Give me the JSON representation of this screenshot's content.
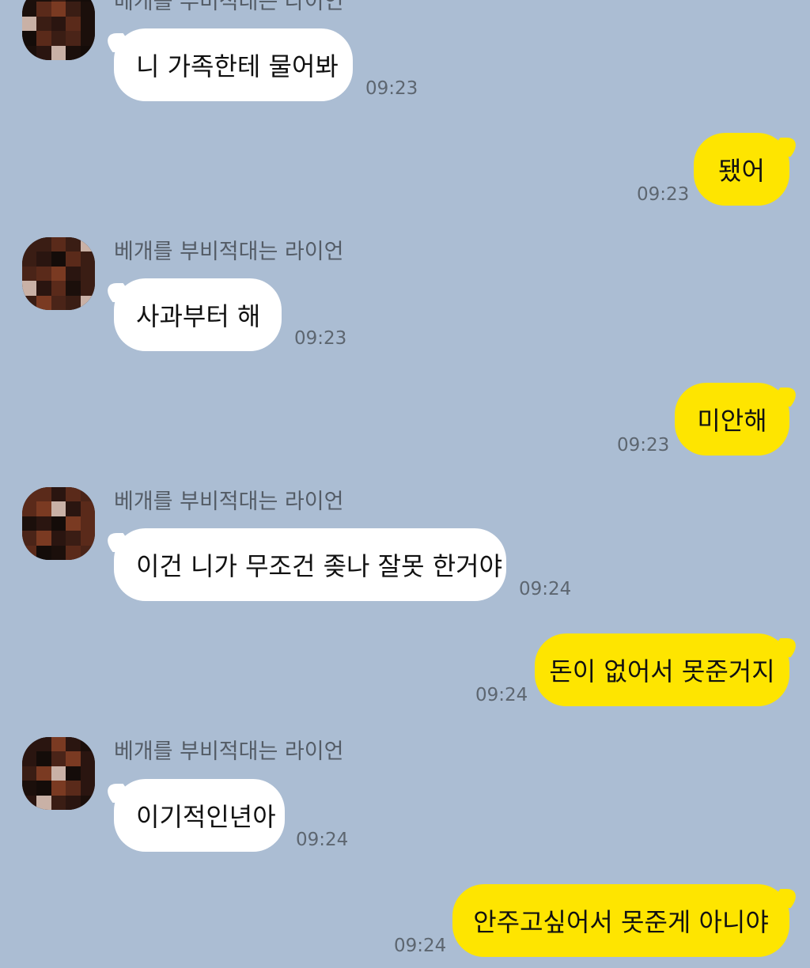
{
  "messages": [
    {
      "side": "in",
      "sender": "베개를 부비적대는 라이언",
      "text": "니 가족한테 물어봐",
      "time": "09:23"
    },
    {
      "side": "out",
      "text": "됐어",
      "time": "09:23"
    },
    {
      "side": "in",
      "sender": "베개를 부비적대는 라이언",
      "text": "사과부터 해",
      "time": "09:23"
    },
    {
      "side": "out",
      "text": "미안해",
      "time": "09:23"
    },
    {
      "side": "in",
      "sender": "베개를 부비적대는 라이언",
      "text": "이건 니가 무조건 좆나 잘못 한거야",
      "time": "09:24"
    },
    {
      "side": "out",
      "text": "돈이 없어서 못준거지",
      "time": "09:24"
    },
    {
      "side": "in",
      "sender": "베개를 부비적대는 라이언",
      "text": "이기적인년아",
      "time": "09:24"
    },
    {
      "side": "out",
      "text": "안주고싶어서 못준게 아니야",
      "time": "09:24"
    }
  ],
  "colors": {
    "background": "#abbdd3",
    "incoming_bubble": "#ffffff",
    "outgoing_bubble": "#fee500"
  }
}
